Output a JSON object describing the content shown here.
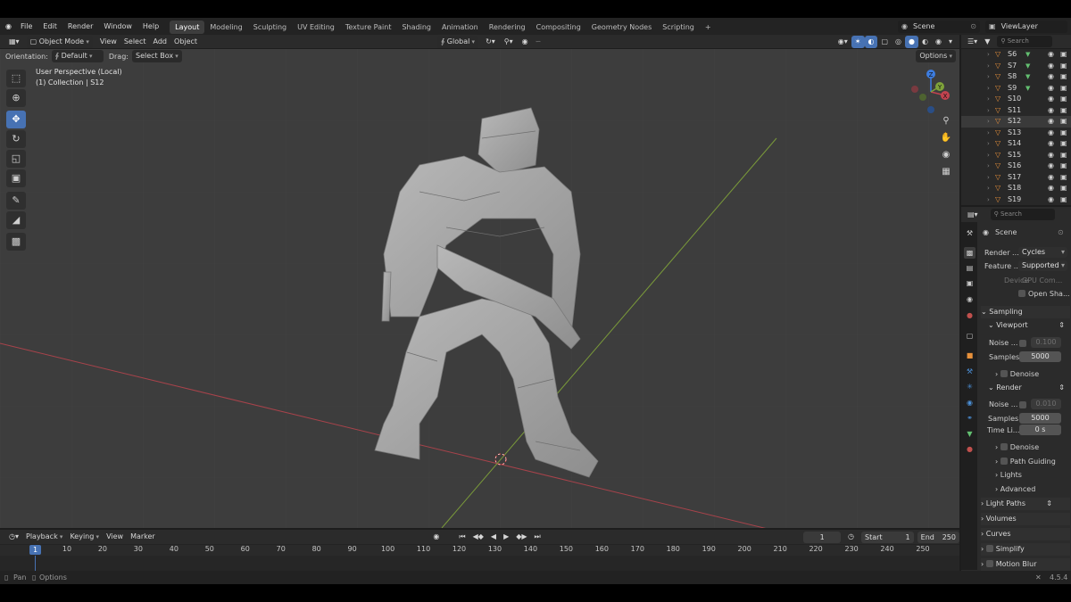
{
  "menubar": {
    "menus": [
      "File",
      "Edit",
      "Render",
      "Window",
      "Help"
    ],
    "workspaces": [
      "Layout",
      "Modeling",
      "Sculpting",
      "UV Editing",
      "Texture Paint",
      "Shading",
      "Animation",
      "Rendering",
      "Compositing",
      "Geometry Nodes",
      "Scripting"
    ],
    "active_workspace": "Layout",
    "add_tab": "+",
    "scene_name": "Scene",
    "view_layer": "ViewLayer"
  },
  "viewport_header": {
    "mode": "Object Mode",
    "menus": [
      "View",
      "Select",
      "Add",
      "Object"
    ],
    "transform_orientation": "Global"
  },
  "tool_settings": {
    "orientation_label": "Orientation:",
    "orientation_value": "Default",
    "drag_label": "Drag:",
    "drag_value": "Select Box",
    "options": "Options"
  },
  "viewport": {
    "perspective_text": "User Perspective (Local)",
    "collection_text": "(1) Collection | S12"
  },
  "gizmo": {
    "x": "X",
    "y": "Y",
    "z": "Z"
  },
  "outliner": {
    "search_placeholder": "Search",
    "items": [
      {
        "name": "S6",
        "has_data": true
      },
      {
        "name": "S7",
        "has_data": true
      },
      {
        "name": "S8",
        "has_data": true
      },
      {
        "name": "S9",
        "has_data": true
      },
      {
        "name": "S10",
        "has_data": false
      },
      {
        "name": "S11",
        "has_data": false
      },
      {
        "name": "S12",
        "has_data": false,
        "selected": true
      },
      {
        "name": "S13",
        "has_data": false
      },
      {
        "name": "S14",
        "has_data": false
      },
      {
        "name": "S15",
        "has_data": false
      },
      {
        "name": "S16",
        "has_data": false
      },
      {
        "name": "S17",
        "has_data": false
      },
      {
        "name": "S18",
        "has_data": false
      },
      {
        "name": "S19",
        "has_data": false
      }
    ]
  },
  "properties": {
    "search_placeholder": "Search",
    "context": "Scene",
    "render_engine_label": "Render ...",
    "render_engine_value": "Cycles",
    "feature_set_label": "Feature ...",
    "feature_set_value": "Supported",
    "device_label": "Device",
    "device_value": "GPU Com...",
    "open_shading": "Open Sha...",
    "sampling": "Sampling",
    "viewport_sub": "Viewport",
    "noise_label": "Noise ...",
    "vp_noise_value": "0.100",
    "samples_label": "Samples",
    "vp_samples": "5000",
    "denoise": "Denoise",
    "render_sub": "Render",
    "r_noise_value": "0.010",
    "r_samples": "5000",
    "time_limit_label": "Time Li...",
    "time_limit_value": "0 s",
    "path_guiding": "Path Guiding",
    "lights": "Lights",
    "advanced": "Advanced",
    "light_paths": "Light Paths",
    "volumes": "Volumes",
    "curves": "Curves",
    "simplify": "Simplify",
    "motion_blur": "Motion Blur"
  },
  "timeline": {
    "menus": [
      "Playback",
      "Keying",
      "View",
      "Marker"
    ],
    "current_frame": "1",
    "start_label": "Start",
    "start_value": "1",
    "end_label": "End",
    "end_value": "250",
    "ticks": [
      "10",
      "20",
      "30",
      "40",
      "50",
      "60",
      "70",
      "80",
      "90",
      "100",
      "110",
      "120",
      "130",
      "140",
      "150",
      "160",
      "170",
      "180",
      "190",
      "200",
      "210",
      "220",
      "230",
      "240",
      "250"
    ],
    "playhead": "1"
  },
  "statusbar": {
    "left1": "Pan",
    "left2": "Options",
    "version": "4.5.4"
  },
  "colors": {
    "accent": "#4772b3",
    "object_orange": "#e8913b",
    "x_axis": "#c2434f",
    "y_axis": "#7fa33a",
    "z_axis": "#3d7de0"
  }
}
